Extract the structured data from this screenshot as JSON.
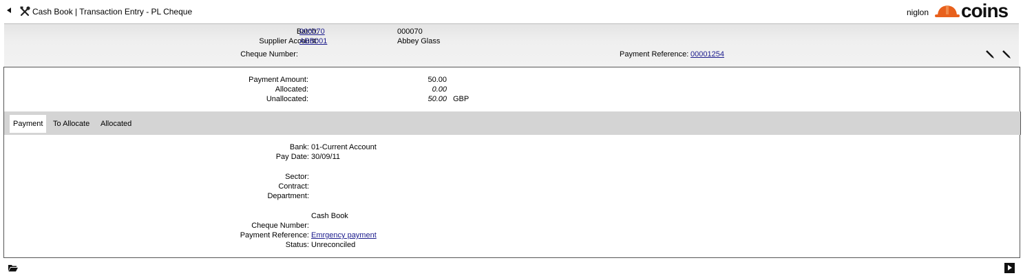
{
  "titlebar": {
    "title": "Cash Book | Transaction Entry - PL Cheque",
    "user": "niglon",
    "logo_text": "COINS"
  },
  "header": {
    "batch_label": "Batch:",
    "batch_value": "000070",
    "batch_description": "000070",
    "supplier_label": "Supplier Account:",
    "supplier_value": "ABB001",
    "supplier_name": "Abbey Glass",
    "cheque_label": "Cheque Number:",
    "cheque_value": "",
    "payment_ref_label": "Payment Reference:",
    "payment_ref_value": "00001254"
  },
  "amounts": {
    "payment_label": "Payment Amount:",
    "payment_value": "50.00",
    "allocated_label": "Allocated:",
    "allocated_value": "0.00",
    "unallocated_label": "Unallocated:",
    "unallocated_value": "50.00",
    "currency": "GBP"
  },
  "tabs": [
    {
      "label": "Payment",
      "active": true
    },
    {
      "label": "To Allocate",
      "active": false
    },
    {
      "label": "Allocated",
      "active": false
    }
  ],
  "detail": {
    "bank_label": "Bank:",
    "bank_value": "01-Current Account",
    "pay_date_label": "Pay Date:",
    "pay_date_value": "30/09/11",
    "sector_label": "Sector:",
    "contract_label": "Contract:",
    "department_label": "Department:",
    "section_title": "Cash Book",
    "cheque_label": "Cheque Number:",
    "payment_ref_label": "Payment Reference:",
    "payment_ref_value": "Emrgency payment",
    "status_label": "Status:",
    "status_value": "Unreconciled"
  },
  "colors": {
    "logo_orange": "#e8601c",
    "link": "#1a1a8c",
    "tab_strip": "#d4d4d4"
  }
}
